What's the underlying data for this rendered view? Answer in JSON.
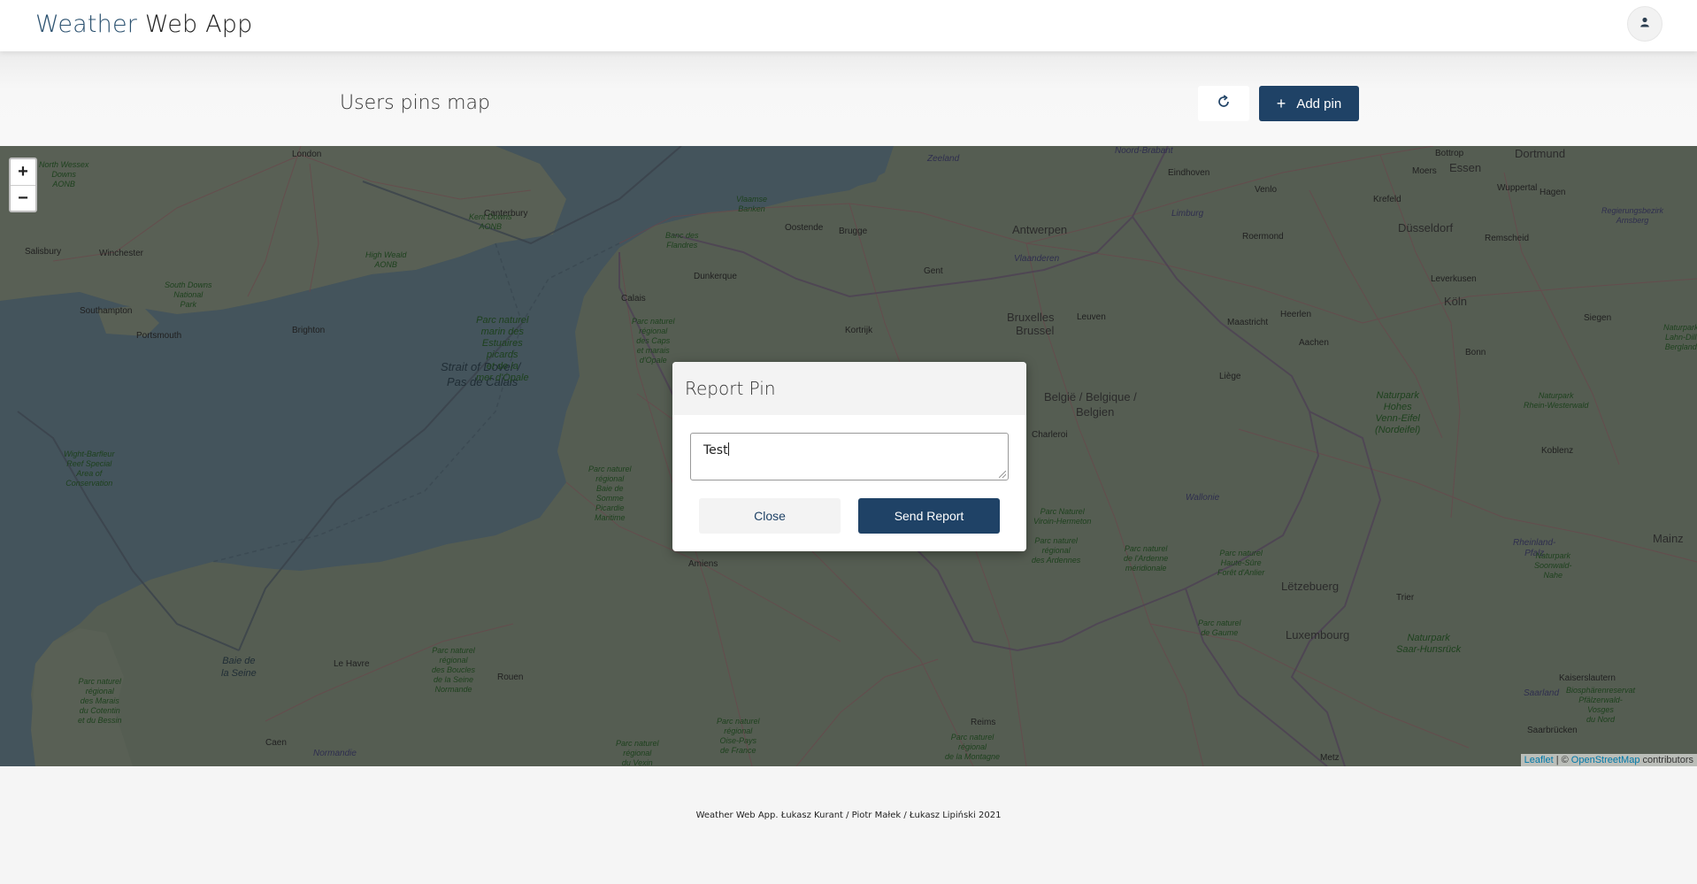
{
  "navbar": {
    "brand_part1": "Weather",
    "brand_part2": "Web App",
    "user_icon": "user-icon"
  },
  "header": {
    "title": "Users pins map",
    "refresh_icon": "refresh-icon",
    "add_pin_label": "Add pin"
  },
  "map": {
    "zoom_in": "+",
    "zoom_out": "−",
    "attribution_leaflet": "Leaflet",
    "attribution_sep": "| ©",
    "attribution_osm": "OpenStreetMap",
    "attribution_tail": "contributors",
    "labels": {
      "london": "London",
      "canterbury": "Canterbury",
      "salisbury": "Salisbury",
      "winchester": "Winchester",
      "southampton": "Southampton",
      "portsmouth": "Portsmouth",
      "brighton": "Brighton",
      "oostende": "Oostende",
      "brugge": "Brugge",
      "antwerpen": "Antwerpen",
      "eindhoven": "Eindhoven",
      "gent": "Gent",
      "dunkerque": "Dunkerque",
      "calais": "Calais",
      "kortrijk": "Kortrijk",
      "bruxelles": "Bruxelles",
      "brussel": "Brussel",
      "leuven": "Leuven",
      "liege": "Liège",
      "maastricht": "Maastricht",
      "heerlen": "Heerlen",
      "aachen": "Aachen",
      "roermond": "Roermond",
      "venlo": "Venlo",
      "krefeld": "Krefeld",
      "dusseldorf": "Düsseldorf",
      "essen": "Essen",
      "dortmund": "Dortmund",
      "wuppertal": "Wuppertal",
      "remscheid": "Remscheid",
      "koln": "Köln",
      "leverkusen": "Leverkusen",
      "bonn": "Bonn",
      "siegen": "Siegen",
      "koblenz": "Koblenz",
      "mainz": "Mainz",
      "charleroi": "Charleroi",
      "belgie": "België / Belgique /",
      "belgien": "Belgien",
      "letzebuerg": "Lëtzebuerg",
      "luxembourg": "Luxembourg",
      "trier": "Trier",
      "saarbrucken": "Saarbrücken",
      "kaiserslautern": "Kaiserslautern",
      "amiens": "Amiens",
      "rouen": "Rouen",
      "le_havre": "Le Havre",
      "caen": "Caen",
      "reims": "Reims",
      "metz": "Metz",
      "normandie": "Normandie",
      "strait": "Strait of Dover /",
      "pas_de_calais": "Pas de Calais",
      "baie_seine": "Baie de\nla Seine",
      "limburg": "Limburg",
      "vlaanderen": "Vlaanderen",
      "wallonie": "Wallonie",
      "saarland": "Saarland",
      "moers": "Moers",
      "bottrop": "Bottrop",
      "hagen": "Hagen",
      "noord_brabant": "Noord-Brabant",
      "zeeland": "Zeeland",
      "rheinland": "Rheinland-\nPfalz",
      "park_naturel_marin": "Parc naturel\nmarin des\nEstuaires\npicards\net de la\nmer d'Opale",
      "kent_downs": "Kent Downs\nAONB",
      "high_weald": "High Weald\nAONB",
      "south_downs": "South Downs\nNational\nPark",
      "north_wessex": "North Wessex\nDowns\nAONB",
      "wight": "Wight-Barfleur\nReef Special\nArea of\nConservation",
      "vlaamse_banken": "Vlaamse\nBanken",
      "banc_flandres": "Banc des\nFlandres",
      "caps_marais": "Parc naturel\nrégional\ndes Caps\net marais\nd'Opale",
      "baie_somme": "Parc naturel\nrégional\nBaie de\nSomme\nPicardie\nMaritime",
      "viroin": "Parc Naturel\nViroin-Hermeton",
      "ardennes_pn": "Parc naturel\nrégional\ndes Ardennes",
      "ardenne_meridionale": "Parc naturel\nde l'Ardenne\nméridionale",
      "haute_sure": "Parc naturel\nHaute-Sûre\nForêt d'Anlier",
      "gaume": "Parc naturel\nde Gaume",
      "hohes_venn": "Naturpark\nHohes\nVenn-Eifel\n(Nordeifel)",
      "rhein_westerwald": "Naturpark\nRhein-Westerwald",
      "soonwald": "Naturpark\nSoonwald-\nNahe",
      "saar_hunsruck": "Naturpark\nSaar-Hunsrück",
      "pfalzerwald": "Biosphärenreservat\nPfälzerwald-\nVosges\ndu Nord",
      "boucles_seine": "Parc naturel\nrégional\ndes Boucles\nde la Seine\nNormande",
      "cotentin": "Parc naturel\nrégional\ndes Marais\ndu Cotentin\net du Bessin",
      "oise": "Parc naturel\nrégional\nOise-Pays\nde France",
      "montagne_reims": "Parc naturel\nrégional\nde la Montagne",
      "vexin": "Parc naturel\nrégional\ndu Vexin",
      "lahn": "Naturpark\nLahn-Dill\nBergland",
      "arnsberg": "Regierungsbezirk\nArnsberg"
    }
  },
  "modal": {
    "title": "Report Pin",
    "textarea_value": "Test",
    "close_label": "Close",
    "send_label": "Send Report"
  },
  "footer": {
    "text": "Weather Web App. Łukasz Kurant / Piotr Małek / Łukasz Lipiński 2021"
  }
}
